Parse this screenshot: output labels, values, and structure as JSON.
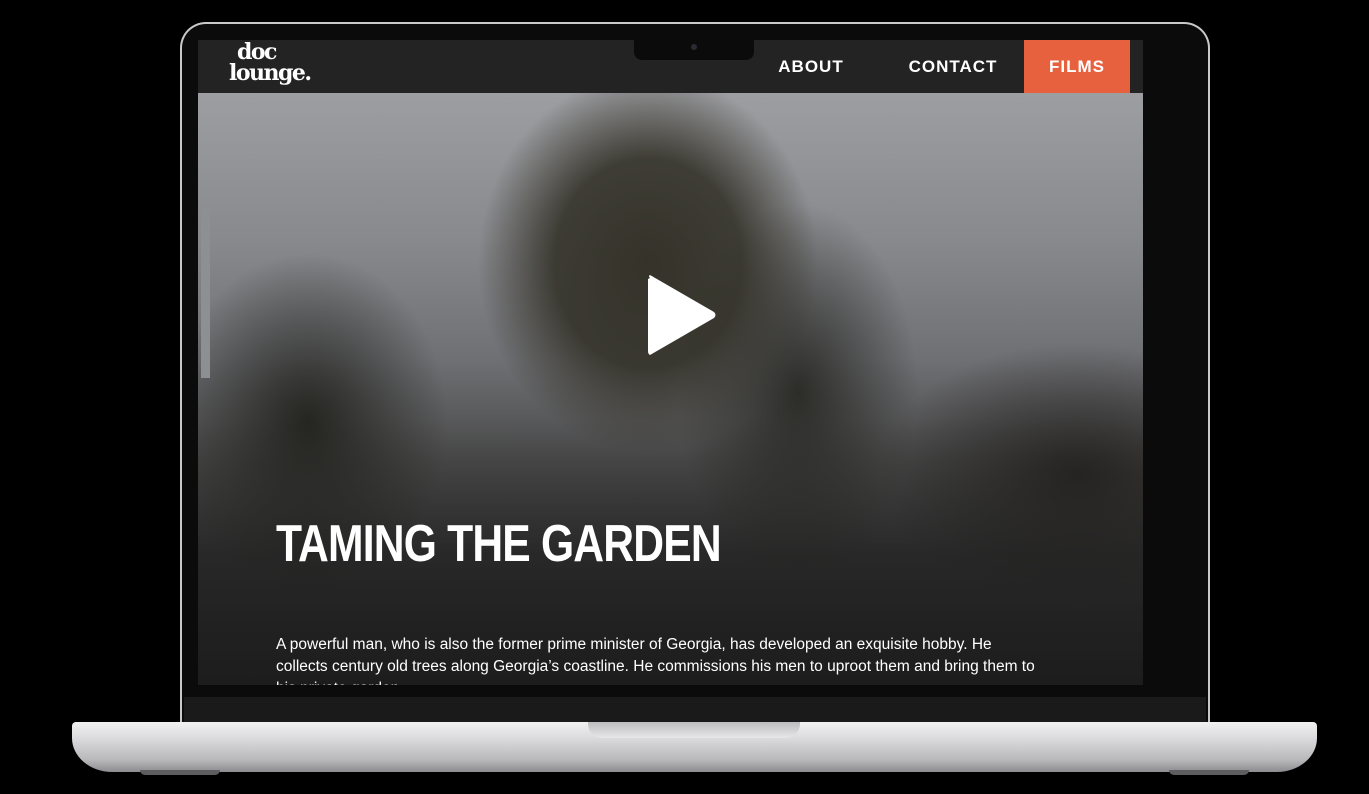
{
  "site": {
    "logo_line1": "doc",
    "logo_line2": "lounge."
  },
  "nav": {
    "items": [
      {
        "label": "ABOUT"
      },
      {
        "label": "CONTACT"
      },
      {
        "label": "FILMS",
        "active": true
      }
    ]
  },
  "hero": {
    "title": "TAMING THE GARDEN",
    "description": "A powerful man, who is also the former prime minister of Georgia, has developed an exquisite hobby. He collects century old trees along Georgia’s coastline. He commissions his men to uproot them and bring them to his private garden.",
    "play_icon": "play-icon"
  },
  "colors": {
    "accent": "#e8613f",
    "header_bg": "#232323",
    "text": "#ffffff"
  }
}
